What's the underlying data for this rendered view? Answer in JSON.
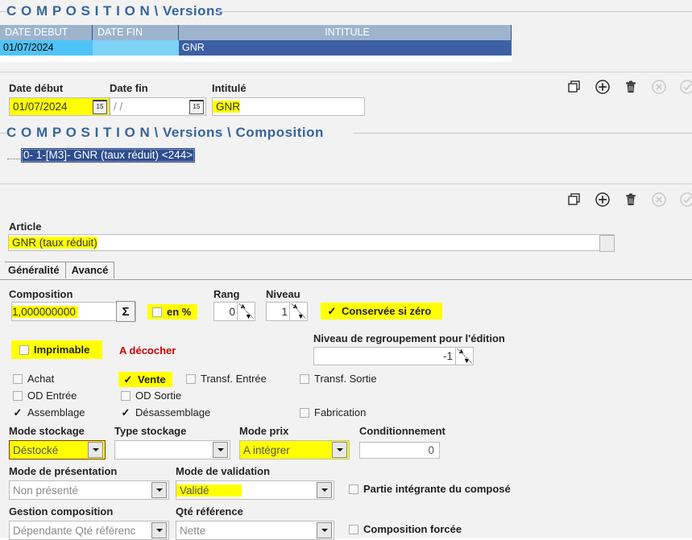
{
  "sections": {
    "versions_title": "C O M P O S I T I O N \\ Versions",
    "composition_title": "C O M P O S I T I O N \\ Versions \\ Composition"
  },
  "versions_grid": {
    "columns": [
      "DATE DEBUT",
      "DATE FIN",
      "INTITULE"
    ],
    "rows": [
      {
        "date_debut": "01/07/2024",
        "date_fin": "",
        "intitule": "GNR"
      }
    ]
  },
  "version_form": {
    "date_debut_label": "Date début",
    "date_debut_value": "01/07/2024",
    "date_fin_label": "Date fin",
    "date_fin_value": "/  /",
    "intitule_label": "Intitulé",
    "intitule_value": "GNR",
    "calendar_icon_text": "15"
  },
  "toolbar": {
    "duplicate": "duplicate-icon",
    "add": "add-icon",
    "delete": "delete-icon",
    "cancel": "cancel-icon",
    "validate": "validate-icon"
  },
  "tree": {
    "items": [
      {
        "label": "0- 1-[M3]- GNR  (taux réduit) <244>",
        "selected": true
      }
    ]
  },
  "article": {
    "label": "Article",
    "value": "GNR  (taux réduit)"
  },
  "tabs": [
    {
      "label": "Généralité",
      "active": true
    },
    {
      "label": "Avancé",
      "active": false
    }
  ],
  "composition": {
    "label": "Composition",
    "value": "1,000000000",
    "sigma_symbol": "Σ",
    "en_pourcent_label": "en %",
    "en_pourcent_checked": false,
    "rang_label": "Rang",
    "rang_value": "0",
    "niveau_label": "Niveau",
    "niveau_value": "1",
    "conservee_label": "Conservée si zéro",
    "conservee_checked": true
  },
  "printing": {
    "imprimable_label": "Imprimable",
    "imprimable_checked": false,
    "note": "A décocher",
    "regroupement_label": "Niveau de regroupement pour l'édition",
    "regroupement_value": "-1"
  },
  "flags": [
    {
      "label": "Achat",
      "checked": false,
      "highlight": false
    },
    {
      "label": "Vente",
      "checked": true,
      "highlight": true
    },
    {
      "label": "Transf. Entrée",
      "checked": false,
      "highlight": false
    },
    {
      "label": "Transf. Sortie",
      "checked": false,
      "highlight": false
    },
    {
      "label": "OD Entrée",
      "checked": false,
      "highlight": false
    },
    {
      "label": "OD Sortie",
      "checked": false,
      "highlight": false
    },
    {
      "label": "Assemblage",
      "checked": true,
      "highlight": false
    },
    {
      "label": "Désassemblage",
      "checked": true,
      "highlight": false
    },
    {
      "label": "Fabrication",
      "checked": false,
      "highlight": false
    }
  ],
  "stock": {
    "mode_stockage_label": "Mode stockage",
    "mode_stockage_value": "Déstocké",
    "type_stockage_label": "Type stockage",
    "type_stockage_value": "",
    "mode_prix_label": "Mode prix",
    "mode_prix_value": "A intégrer",
    "conditionnement_label": "Conditionnement",
    "conditionnement_value": "0"
  },
  "presentation": {
    "mode_presentation_label": "Mode de présentation",
    "mode_presentation_value": "Non présenté",
    "mode_validation_label": "Mode de validation",
    "mode_validation_value": "Validé",
    "partie_integrante_label": "Partie intégrante du composé",
    "partie_integrante_checked": false
  },
  "gestion": {
    "gestion_composition_label": "Gestion composition",
    "gestion_composition_value": "Dépendante  Qté référenc",
    "qte_reference_label": "Qté référence",
    "qte_reference_value": "Nette",
    "composition_forcee_label": "Composition forcée",
    "composition_forcee_checked": false
  },
  "colors": {
    "highlight": "#ffff00",
    "title_blue": "#36659b",
    "grid_header": "#9db4cd",
    "grid_row_date": "#4fc3f7",
    "grid_row_intitule": "#3d5fa4",
    "note_red": "#cc0000",
    "tree_selected": "#2f4d8f"
  }
}
